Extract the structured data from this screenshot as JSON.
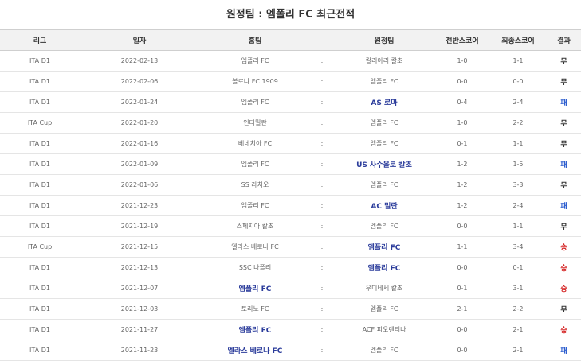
{
  "title": "원정팀 : 엠폴리 FC 최근전적",
  "headers": [
    "리그",
    "일자",
    "홈팀",
    "",
    "원정팀",
    "전반스코어",
    "최종스코어",
    "결과"
  ],
  "colors": {
    "winner_team": "#2b3c9b",
    "result_lose": "#2255cc",
    "result_win": "#d42020"
  },
  "rows": [
    {
      "league": "ITA D1",
      "date": "2022-02-13",
      "home": "엠폴리 FC",
      "sep": ":",
      "away": "칼리아리 칼초",
      "half": "1-0",
      "final": "1-1",
      "result": "무",
      "hi": "",
      "res_type": "draw"
    },
    {
      "league": "ITA D1",
      "date": "2022-02-06",
      "home": "볼로냐 FC 1909",
      "sep": ":",
      "away": "엠폴리 FC",
      "half": "0-0",
      "final": "0-0",
      "result": "무",
      "hi": "",
      "res_type": "draw"
    },
    {
      "league": "ITA D1",
      "date": "2022-01-24",
      "home": "엠폴리 FC",
      "sep": ":",
      "away": "AS 로마",
      "half": "0-4",
      "final": "2-4",
      "result": "패",
      "hi": "away",
      "res_type": "lose"
    },
    {
      "league": "ITA Cup",
      "date": "2022-01-20",
      "home": "인터밀란",
      "sep": ":",
      "away": "엠폴리 FC",
      "half": "1-0",
      "final": "2-2",
      "result": "무",
      "hi": "",
      "res_type": "draw"
    },
    {
      "league": "ITA D1",
      "date": "2022-01-16",
      "home": "베네치아 FC",
      "sep": ":",
      "away": "엠폴리 FC",
      "half": "0-1",
      "final": "1-1",
      "result": "무",
      "hi": "",
      "res_type": "draw"
    },
    {
      "league": "ITA D1",
      "date": "2022-01-09",
      "home": "엠폴리 FC",
      "sep": ":",
      "away": "US 사수올로 칼초",
      "half": "1-2",
      "final": "1-5",
      "result": "패",
      "hi": "away",
      "res_type": "lose"
    },
    {
      "league": "ITA D1",
      "date": "2022-01-06",
      "home": "SS 라치오",
      "sep": ":",
      "away": "엠폴리 FC",
      "half": "1-2",
      "final": "3-3",
      "result": "무",
      "hi": "",
      "res_type": "draw"
    },
    {
      "league": "ITA D1",
      "date": "2021-12-23",
      "home": "엠폴리 FC",
      "sep": ":",
      "away": "AC 밀란",
      "half": "1-2",
      "final": "2-4",
      "result": "패",
      "hi": "away",
      "res_type": "lose"
    },
    {
      "league": "ITA D1",
      "date": "2021-12-19",
      "home": "스페치아 칼초",
      "sep": ":",
      "away": "엠폴리 FC",
      "half": "0-0",
      "final": "1-1",
      "result": "무",
      "hi": "",
      "res_type": "draw"
    },
    {
      "league": "ITA Cup",
      "date": "2021-12-15",
      "home": "엘라스 베로나 FC",
      "sep": ":",
      "away": "엠폴리 FC",
      "half": "1-1",
      "final": "3-4",
      "result": "승",
      "hi": "away",
      "res_type": "win"
    },
    {
      "league": "ITA D1",
      "date": "2021-12-13",
      "home": "SSC 나폴리",
      "sep": ":",
      "away": "엠폴리 FC",
      "half": "0-0",
      "final": "0-1",
      "result": "승",
      "hi": "away",
      "res_type": "win"
    },
    {
      "league": "ITA D1",
      "date": "2021-12-07",
      "home": "엠폴리 FC",
      "sep": ":",
      "away": "우디네세 칼초",
      "half": "0-1",
      "final": "3-1",
      "result": "승",
      "hi": "home",
      "res_type": "win"
    },
    {
      "league": "ITA D1",
      "date": "2021-12-03",
      "home": "토리노 FC",
      "sep": ":",
      "away": "엠폴리 FC",
      "half": "2-1",
      "final": "2-2",
      "result": "무",
      "hi": "",
      "res_type": "draw"
    },
    {
      "league": "ITA D1",
      "date": "2021-11-27",
      "home": "엠폴리 FC",
      "sep": ":",
      "away": "ACF 피오렌티나",
      "half": "0-0",
      "final": "2-1",
      "result": "승",
      "hi": "home",
      "res_type": "win"
    },
    {
      "league": "ITA D1",
      "date": "2021-11-23",
      "home": "엘라스 베로나 FC",
      "sep": ":",
      "away": "엠폴리 FC",
      "half": "0-0",
      "final": "2-1",
      "result": "패",
      "hi": "home",
      "res_type": "lose"
    }
  ]
}
